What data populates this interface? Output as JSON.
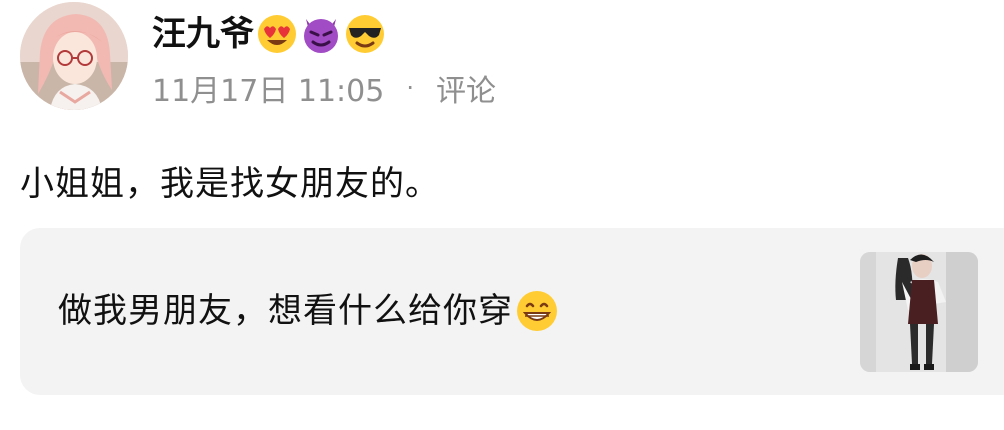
{
  "author": {
    "name": "汪九爷",
    "badges": [
      "heart-eyes-emoji",
      "smiling-devil-emoji",
      "sunglasses-emoji"
    ]
  },
  "meta": {
    "date": "11月17日 11:05",
    "separator": "·",
    "comment_label": "评论"
  },
  "post": {
    "text": "小姐姐，我是找女朋友的。"
  },
  "quote": {
    "text": "做我男朋友，想看什么给你穿",
    "trailing_emoji": "grinning-emoji",
    "thumbnail": "photo-thumbnail"
  }
}
